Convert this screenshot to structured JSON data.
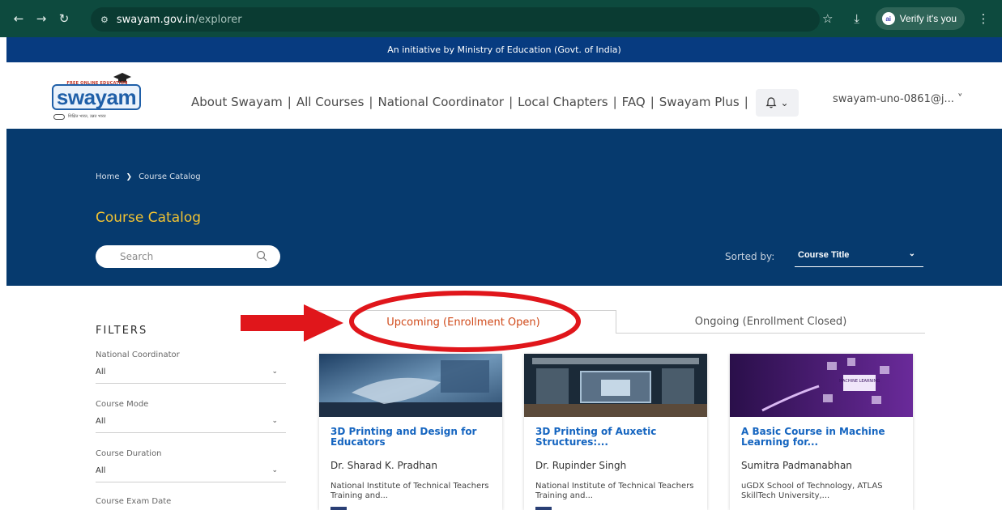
{
  "browser": {
    "url_host": "swayam.gov.in",
    "url_path": "/explorer",
    "verify_label": "Verify it's you"
  },
  "initiative_text": "An initiative by Ministry of Education (Govt. of India)",
  "logo": {
    "tagline": "FREE ONLINE EDUCATION",
    "word": "swayam",
    "sub": "शिक्षित भारत, उन्नत भारत"
  },
  "nav": {
    "items": [
      "About Swayam",
      "All Courses",
      "National Coordinator",
      "Local Chapters",
      "FAQ",
      "Swayam Plus"
    ],
    "separator": "|",
    "user": "swayam-uno-0861@j... ˅"
  },
  "hero": {
    "breadcrumb_home": "Home",
    "breadcrumb_current": "Course Catalog",
    "title": "Course Catalog",
    "search_placeholder": "Search",
    "sorted_by_label": "Sorted by:",
    "sort_value": "Course Title"
  },
  "filters": {
    "title": "FILTERS",
    "items": [
      {
        "label": "National Coordinator",
        "value": "All"
      },
      {
        "label": "Course Mode",
        "value": "All"
      },
      {
        "label": "Course Duration",
        "value": "All"
      },
      {
        "label": "Course Exam Date",
        "value": ""
      }
    ]
  },
  "tabs": {
    "upcoming": "Upcoming (Enrollment Open)",
    "ongoing": "Ongoing (Enrollment Closed)"
  },
  "courses": [
    {
      "title": "3D Printing and Design for Educators",
      "instructor": "Dr. Sharad K. Pradhan",
      "institute": "National Institute of Technical Teachers Training and..."
    },
    {
      "title": "3D Printing of Auxetic Structures:...",
      "instructor": "Dr. Rupinder Singh",
      "institute": "National Institute of Technical Teachers Training and..."
    },
    {
      "title": "A Basic Course in Machine Learning for...",
      "instructor": "Sumitra Padmanabhan",
      "institute": "uGDX School of Technology, ATLAS SkillTech University,...",
      "thumb_text": "MACHINE LEARNING"
    }
  ],
  "colors": {
    "chrome": "#0d4a3e",
    "initiative_bar": "#073b80",
    "hero": "#063a6e",
    "hero_title": "#f1c232",
    "active_tab": "#d04a1a",
    "course_title": "#1565c0",
    "annotation": "#e0161b"
  }
}
